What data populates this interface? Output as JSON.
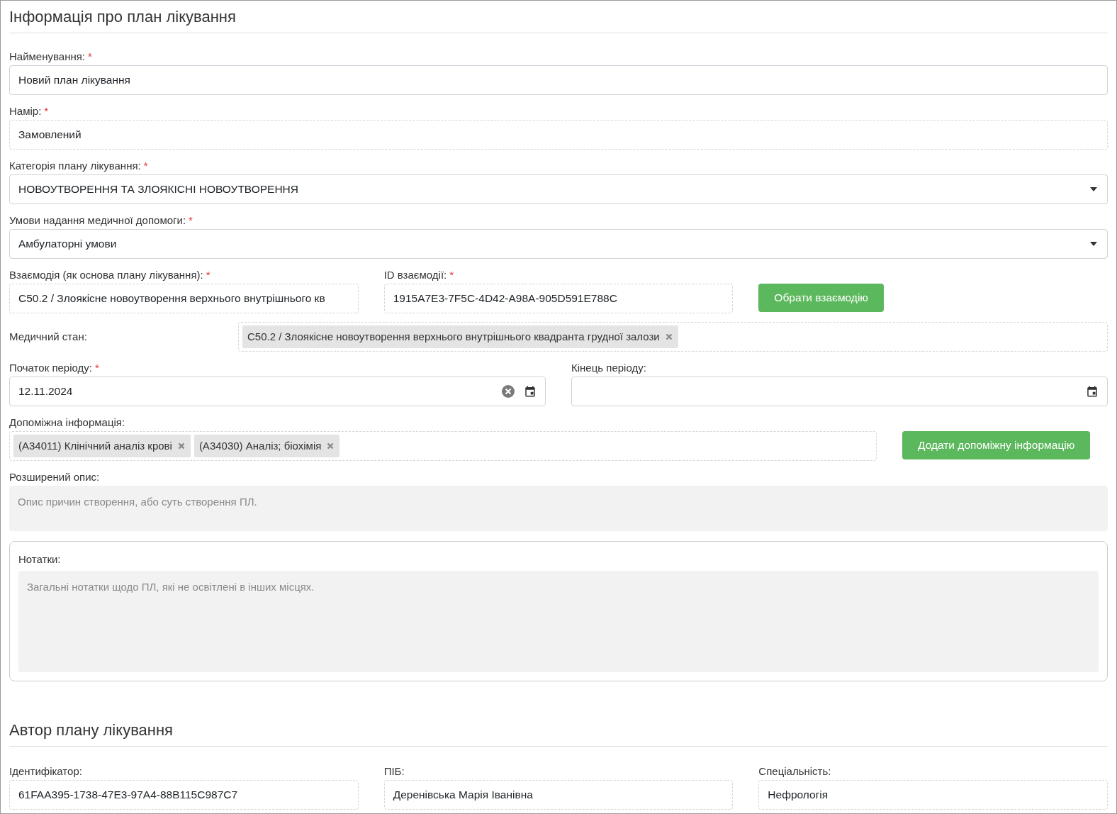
{
  "section_title": "Інформація про план лікування",
  "rows": [
    {
      "fields": [
        {
          "kind": "input",
          "label": "Найменування:",
          "required_mark": "*",
          "value": "Новий план лікування"
        }
      ]
    },
    {
      "fields": [
        {
          "kind": "readonly",
          "label": "Намір:",
          "required_mark": "*",
          "value": "Замовлений"
        }
      ]
    },
    {
      "fields": [
        {
          "kind": "select",
          "label": "Категорія плану лікування:",
          "required_mark": "*",
          "value": "НОВОУТВОРЕННЯ ТА ЗЛОЯКІСНІ НОВОУТВОРЕННЯ"
        }
      ]
    },
    {
      "fields": [
        {
          "kind": "select",
          "label": "Умови надання медичної допомоги:",
          "required_mark": "*",
          "value": "Амбулаторні умови"
        }
      ]
    },
    {
      "fields": [
        {
          "kind": "readonly",
          "label": "Взаємодія (як основа плану лікування):",
          "required_mark": "*",
          "value": "C50.2 / Злоякісне новоутворення верхнього внутрішнього кв"
        },
        {
          "kind": "readonly",
          "label": "ID взаємодії:",
          "required_mark": "*",
          "value": "1915A7E3-7F5C-4D42-A98A-905D591E788C"
        },
        {
          "kind": "button",
          "label": "Обрати взаємодію"
        }
      ]
    },
    {
      "fields": [
        {
          "kind": "tags",
          "label": "Медичний стан:",
          "tags": [
            "C50.2 / Злоякісне новоутворення верхнього внутрішнього квадранта грудної залози"
          ]
        }
      ]
    },
    {
      "fields": [
        {
          "kind": "date",
          "label": "Початок періоду:",
          "required_mark": "*",
          "value": "12.11.2024",
          "clearable": true
        },
        {
          "kind": "date",
          "label": "Кінець періоду:",
          "clearable": false
        }
      ]
    },
    {
      "fields": [
        {
          "kind": "tags",
          "label": "Допоміжна інформація:",
          "tags": [
            "(А34011) Клінічний аналіз крові",
            "(А34030) Аналіз; біохімія"
          ]
        },
        {
          "kind": "button",
          "label": "Додати допоміжну інформацію"
        }
      ]
    },
    {
      "fields": [
        {
          "kind": "textarea",
          "label": "Розширений опис:",
          "placeholder": "Опис причин створення, або суть створення ПЛ."
        }
      ]
    }
  ],
  "notes_card": {
    "label": "Нотатки:",
    "placeholder": "Загальні нотатки щодо ПЛ, які не освітлені в інших місцях."
  },
  "author_title": "Автор плану лікування",
  "author_fields": [
    {
      "label": "Ідентифікатор:",
      "value": "61FAA395-1738-47E3-97A4-88B115C987C7"
    },
    {
      "label": "ПІБ:",
      "value": "Деренівська Марія Іванівна"
    },
    {
      "label": "Спеціальність:",
      "value": "Нефрологія"
    }
  ]
}
